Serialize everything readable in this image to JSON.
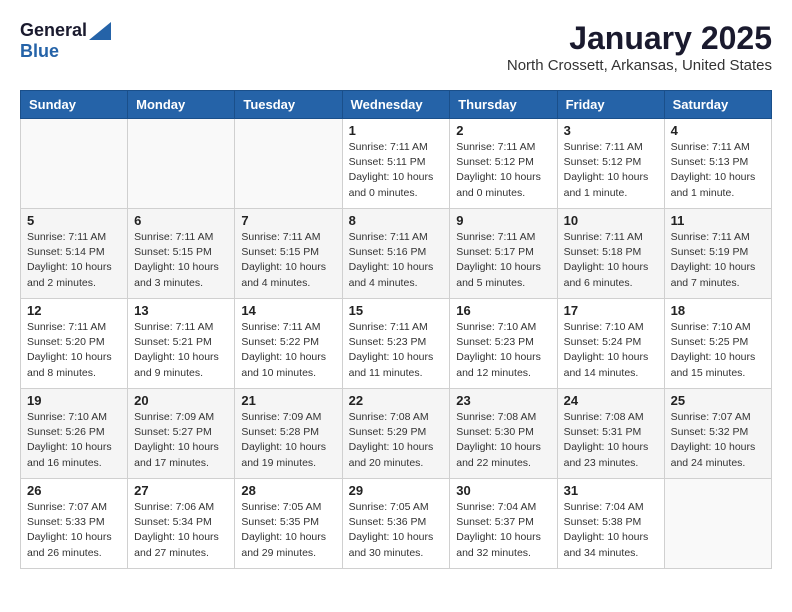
{
  "logo": {
    "general": "General",
    "blue": "Blue"
  },
  "title": "January 2025",
  "location": "North Crossett, Arkansas, United States",
  "weekdays": [
    "Sunday",
    "Monday",
    "Tuesday",
    "Wednesday",
    "Thursday",
    "Friday",
    "Saturday"
  ],
  "weeks": [
    [
      {
        "day": null,
        "info": null
      },
      {
        "day": null,
        "info": null
      },
      {
        "day": null,
        "info": null
      },
      {
        "day": "1",
        "info": "Sunrise: 7:11 AM\nSunset: 5:11 PM\nDaylight: 10 hours\nand 0 minutes."
      },
      {
        "day": "2",
        "info": "Sunrise: 7:11 AM\nSunset: 5:12 PM\nDaylight: 10 hours\nand 0 minutes."
      },
      {
        "day": "3",
        "info": "Sunrise: 7:11 AM\nSunset: 5:12 PM\nDaylight: 10 hours\nand 1 minute."
      },
      {
        "day": "4",
        "info": "Sunrise: 7:11 AM\nSunset: 5:13 PM\nDaylight: 10 hours\nand 1 minute."
      }
    ],
    [
      {
        "day": "5",
        "info": "Sunrise: 7:11 AM\nSunset: 5:14 PM\nDaylight: 10 hours\nand 2 minutes."
      },
      {
        "day": "6",
        "info": "Sunrise: 7:11 AM\nSunset: 5:15 PM\nDaylight: 10 hours\nand 3 minutes."
      },
      {
        "day": "7",
        "info": "Sunrise: 7:11 AM\nSunset: 5:15 PM\nDaylight: 10 hours\nand 4 minutes."
      },
      {
        "day": "8",
        "info": "Sunrise: 7:11 AM\nSunset: 5:16 PM\nDaylight: 10 hours\nand 4 minutes."
      },
      {
        "day": "9",
        "info": "Sunrise: 7:11 AM\nSunset: 5:17 PM\nDaylight: 10 hours\nand 5 minutes."
      },
      {
        "day": "10",
        "info": "Sunrise: 7:11 AM\nSunset: 5:18 PM\nDaylight: 10 hours\nand 6 minutes."
      },
      {
        "day": "11",
        "info": "Sunrise: 7:11 AM\nSunset: 5:19 PM\nDaylight: 10 hours\nand 7 minutes."
      }
    ],
    [
      {
        "day": "12",
        "info": "Sunrise: 7:11 AM\nSunset: 5:20 PM\nDaylight: 10 hours\nand 8 minutes."
      },
      {
        "day": "13",
        "info": "Sunrise: 7:11 AM\nSunset: 5:21 PM\nDaylight: 10 hours\nand 9 minutes."
      },
      {
        "day": "14",
        "info": "Sunrise: 7:11 AM\nSunset: 5:22 PM\nDaylight: 10 hours\nand 10 minutes."
      },
      {
        "day": "15",
        "info": "Sunrise: 7:11 AM\nSunset: 5:23 PM\nDaylight: 10 hours\nand 11 minutes."
      },
      {
        "day": "16",
        "info": "Sunrise: 7:10 AM\nSunset: 5:23 PM\nDaylight: 10 hours\nand 12 minutes."
      },
      {
        "day": "17",
        "info": "Sunrise: 7:10 AM\nSunset: 5:24 PM\nDaylight: 10 hours\nand 14 minutes."
      },
      {
        "day": "18",
        "info": "Sunrise: 7:10 AM\nSunset: 5:25 PM\nDaylight: 10 hours\nand 15 minutes."
      }
    ],
    [
      {
        "day": "19",
        "info": "Sunrise: 7:10 AM\nSunset: 5:26 PM\nDaylight: 10 hours\nand 16 minutes."
      },
      {
        "day": "20",
        "info": "Sunrise: 7:09 AM\nSunset: 5:27 PM\nDaylight: 10 hours\nand 17 minutes."
      },
      {
        "day": "21",
        "info": "Sunrise: 7:09 AM\nSunset: 5:28 PM\nDaylight: 10 hours\nand 19 minutes."
      },
      {
        "day": "22",
        "info": "Sunrise: 7:08 AM\nSunset: 5:29 PM\nDaylight: 10 hours\nand 20 minutes."
      },
      {
        "day": "23",
        "info": "Sunrise: 7:08 AM\nSunset: 5:30 PM\nDaylight: 10 hours\nand 22 minutes."
      },
      {
        "day": "24",
        "info": "Sunrise: 7:08 AM\nSunset: 5:31 PM\nDaylight: 10 hours\nand 23 minutes."
      },
      {
        "day": "25",
        "info": "Sunrise: 7:07 AM\nSunset: 5:32 PM\nDaylight: 10 hours\nand 24 minutes."
      }
    ],
    [
      {
        "day": "26",
        "info": "Sunrise: 7:07 AM\nSunset: 5:33 PM\nDaylight: 10 hours\nand 26 minutes."
      },
      {
        "day": "27",
        "info": "Sunrise: 7:06 AM\nSunset: 5:34 PM\nDaylight: 10 hours\nand 27 minutes."
      },
      {
        "day": "28",
        "info": "Sunrise: 7:05 AM\nSunset: 5:35 PM\nDaylight: 10 hours\nand 29 minutes."
      },
      {
        "day": "29",
        "info": "Sunrise: 7:05 AM\nSunset: 5:36 PM\nDaylight: 10 hours\nand 30 minutes."
      },
      {
        "day": "30",
        "info": "Sunrise: 7:04 AM\nSunset: 5:37 PM\nDaylight: 10 hours\nand 32 minutes."
      },
      {
        "day": "31",
        "info": "Sunrise: 7:04 AM\nSunset: 5:38 PM\nDaylight: 10 hours\nand 34 minutes."
      },
      {
        "day": null,
        "info": null
      }
    ]
  ]
}
